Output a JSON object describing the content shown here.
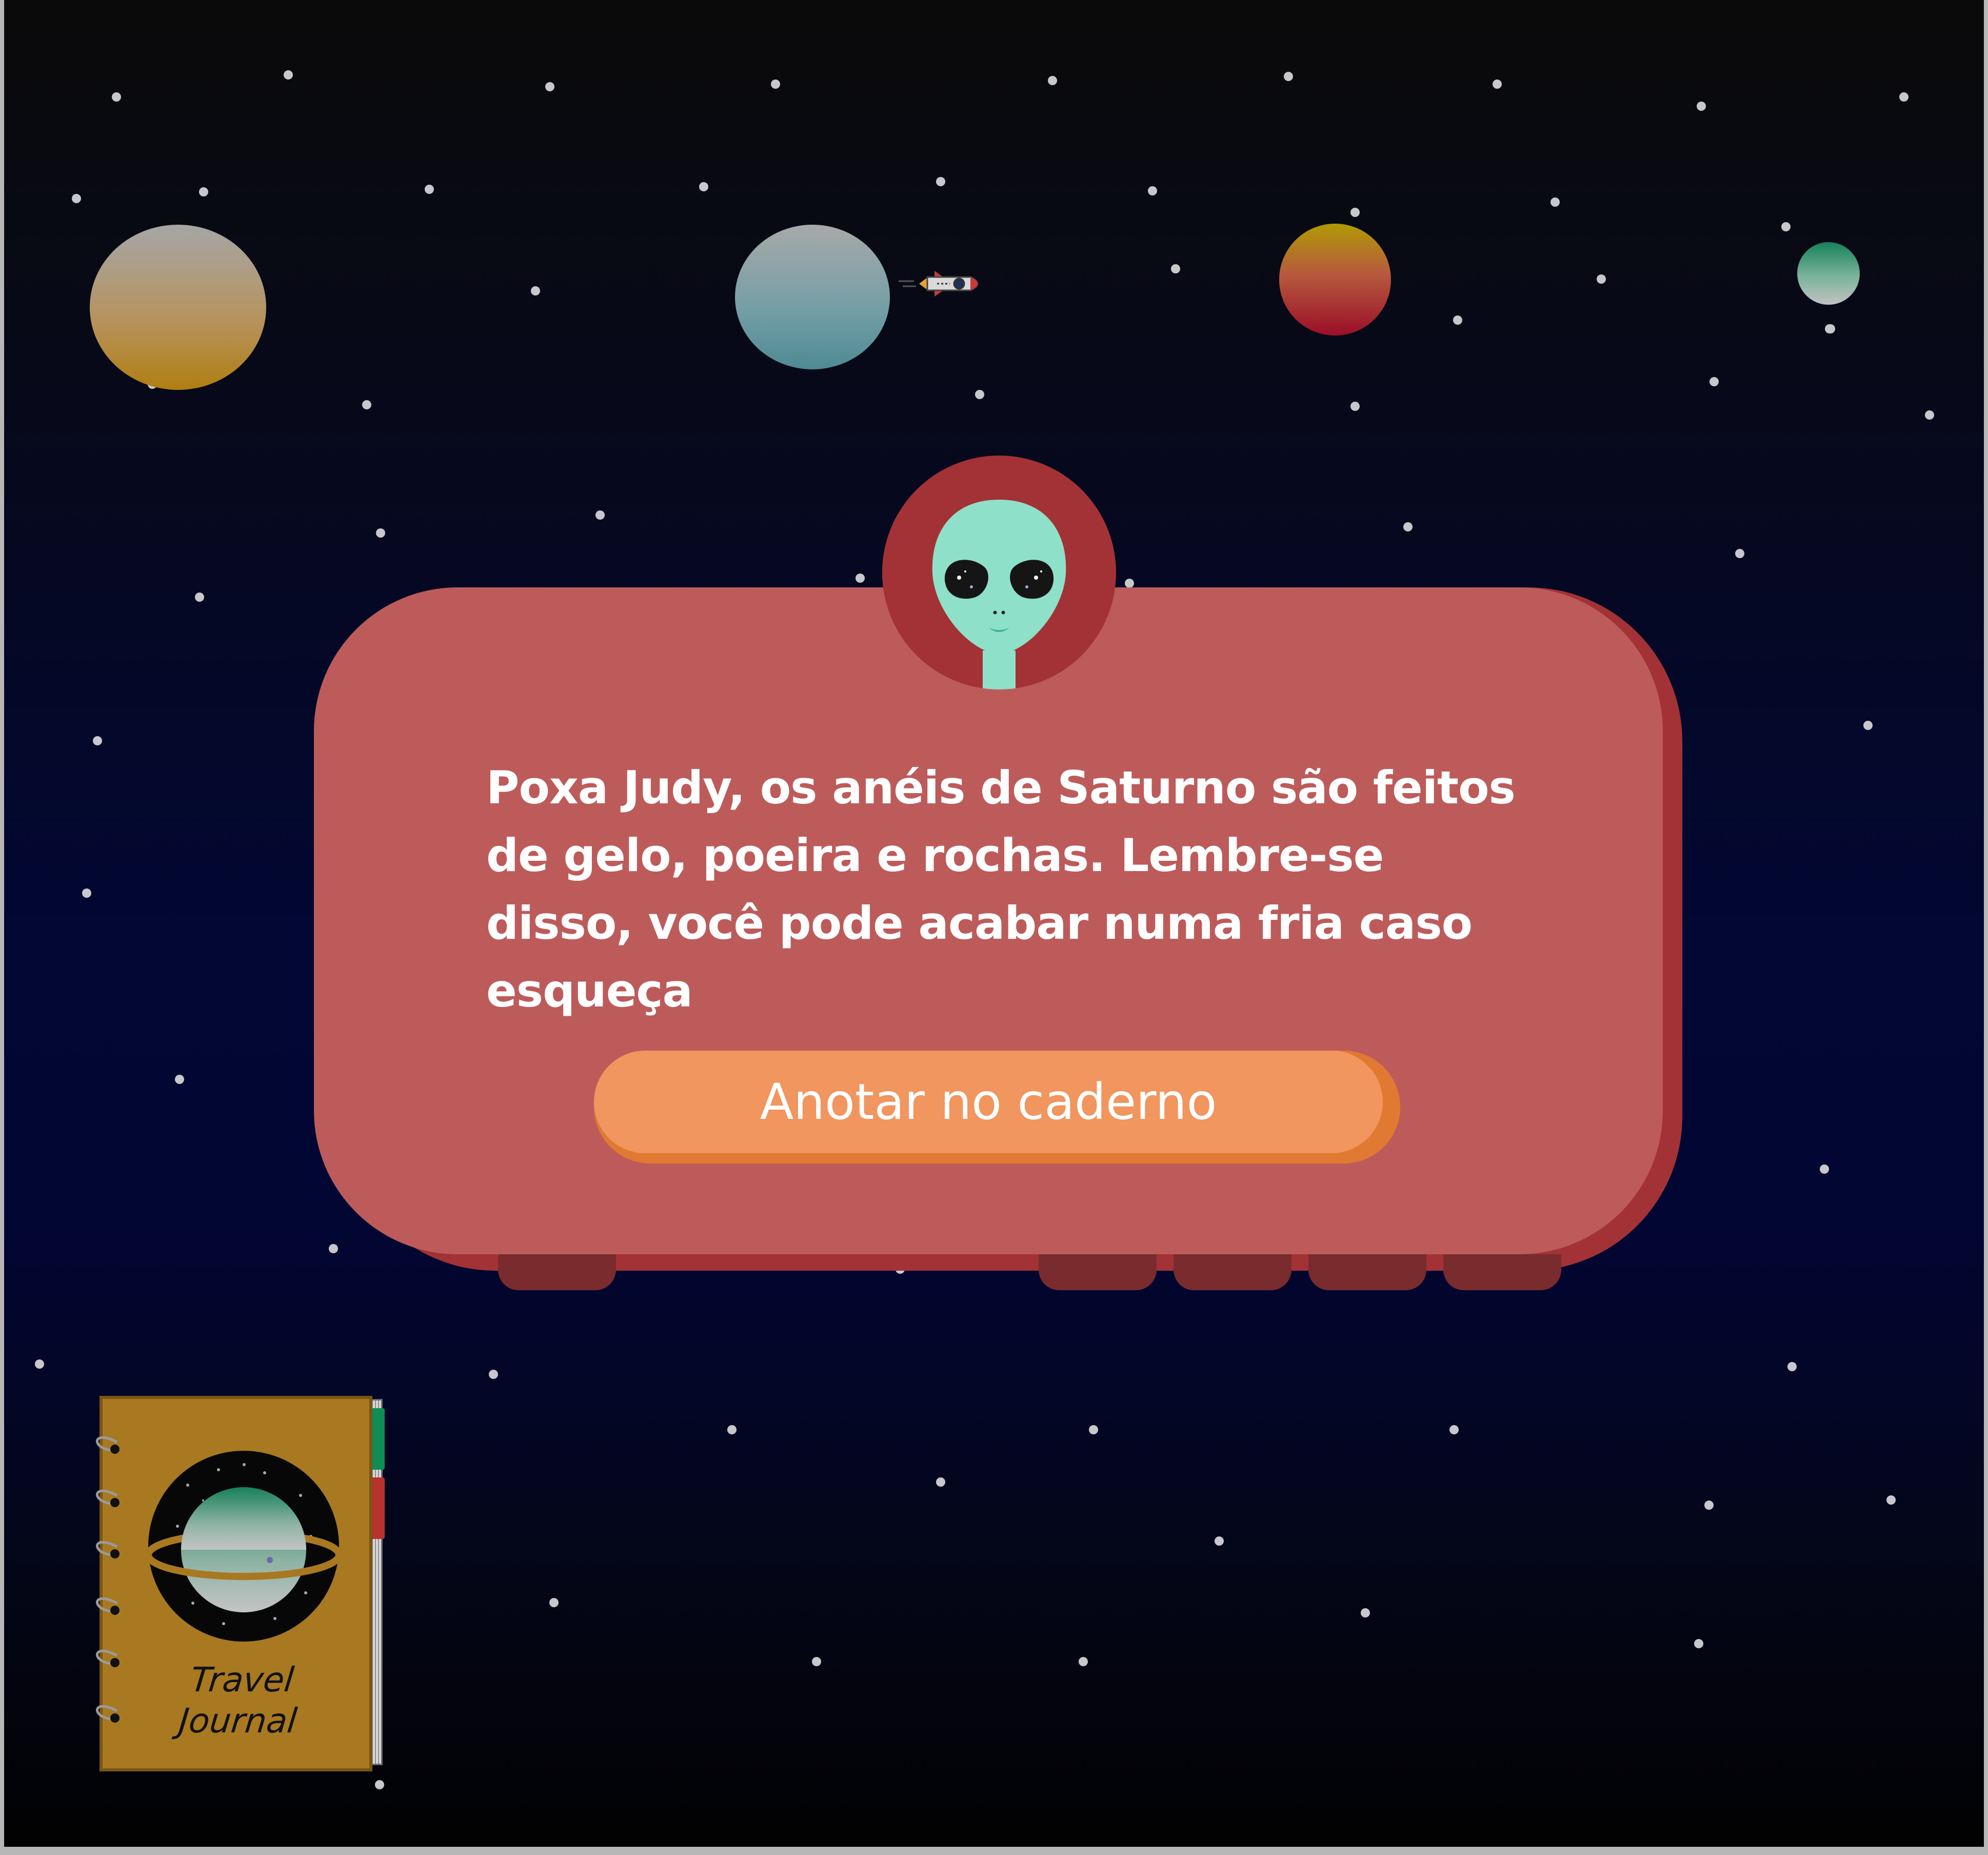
{
  "dialog": {
    "speaker_avatar": "alien-icon",
    "message": "Poxa Judy, os anéis de Saturno são feitos de gelo, poeira e rochas. Lembre-se disso, você pode acabar numa fria caso esqueça",
    "action_button_label": "Anotar no caderno"
  },
  "journal": {
    "title_line_1": "Travel",
    "title_line_2": "Journal",
    "icon": "travel-journal-icon"
  },
  "scene": {
    "rocket_icon": "rocket-icon",
    "planet_count": 4
  },
  "colors": {
    "dialog_background": "#bd5b5b",
    "dialog_border": "#a33236",
    "button_background": "#f0965e",
    "button_shadow": "#e07a32",
    "alien_skin": "#8fe0c8",
    "journal_cover": "#a87921"
  }
}
